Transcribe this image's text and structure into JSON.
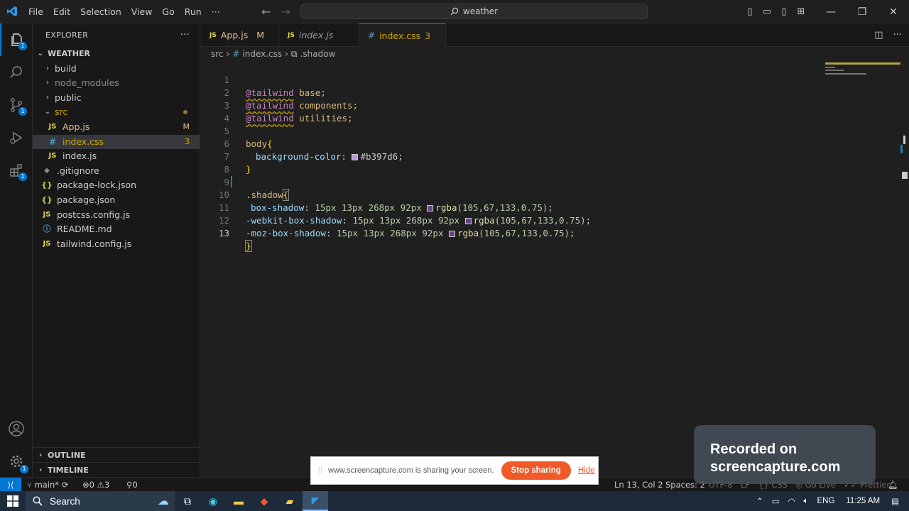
{
  "window": {
    "menu": [
      "File",
      "Edit",
      "Selection",
      "View",
      "Go",
      "Run",
      "···"
    ],
    "search_text": "weather"
  },
  "explorer": {
    "header": "EXPLORER",
    "more": "···",
    "root": "WEATHER",
    "items": [
      {
        "label": "build",
        "type": "folder",
        "depth": 1
      },
      {
        "label": "node_modules",
        "type": "folder",
        "depth": 1
      },
      {
        "label": "public",
        "type": "folder",
        "depth": 1
      },
      {
        "label": "src",
        "type": "folder-open",
        "depth": 1
      },
      {
        "label": "App.js",
        "type": "js",
        "depth": 2,
        "badge": "M"
      },
      {
        "label": "index.css",
        "type": "css",
        "depth": 2,
        "badge": "3"
      },
      {
        "label": "index.js",
        "type": "js",
        "depth": 2
      },
      {
        "label": ".gitignore",
        "type": "git",
        "depth": 1
      },
      {
        "label": "package-lock.json",
        "type": "json",
        "depth": 1
      },
      {
        "label": "package.json",
        "type": "json",
        "depth": 1
      },
      {
        "label": "postcss.config.js",
        "type": "js",
        "depth": 1
      },
      {
        "label": "README.md",
        "type": "info",
        "depth": 1
      },
      {
        "label": "tailwind.config.js",
        "type": "js",
        "depth": 1
      }
    ],
    "outline": "OUTLINE",
    "timeline": "TIMELINE"
  },
  "activity": {
    "explorer_badge": "1",
    "scm_badge": "1",
    "extensions_badge": "1"
  },
  "tabs": [
    {
      "label": "App.js",
      "icon": "JS",
      "badge": "M"
    },
    {
      "label": "index.js",
      "icon": "JS"
    },
    {
      "label": "index.css",
      "icon": "#",
      "badge": "3"
    }
  ],
  "breadcrumb": {
    "folder": "src",
    "file": "index.css",
    "symbol": ".shadow"
  },
  "code": {
    "line_numbers": [
      "1",
      "2",
      "3",
      "4",
      "5",
      "6",
      "7",
      "8",
      "9",
      "10",
      "11",
      "12",
      "13"
    ],
    "l1": {
      "at": "@tailwind",
      "rest": " base;"
    },
    "l2": {
      "at": "@tailwind",
      "rest": " components;"
    },
    "l3": {
      "at": "@tailwind",
      "rest": " utilities;"
    },
    "l5": {
      "sel": "body",
      "brace": "{"
    },
    "l6": {
      "prop": "background-color",
      "colon": ": ",
      "value": "#b397d6",
      "end": ";",
      "swatch": "#b397d6"
    },
    "l7": {
      "brace": "}"
    },
    "l9": {
      "sel": ".shadow",
      "brace": "{"
    },
    "l10": {
      "prop": "box-shadow",
      "colon": ": ",
      "nums": "15px 13px 268px 92px ",
      "fn": "rgba",
      "args": "(105,67,133,0.75)",
      "end": ";"
    },
    "l11": {
      "prop": "-webkit-box-shadow",
      "colon": ": ",
      "nums": "15px 13px 268px 92px ",
      "fn": "rgba",
      "args": "(105,67,133,0.75)",
      "end": ";"
    },
    "l12": {
      "prop": "-moz-box-shadow",
      "colon": ": ",
      "nums": "15px 13px 268px 92px ",
      "fn": "rgba",
      "args": "(105,67,133,0.75)",
      "end": ";"
    },
    "l13": {
      "brace": "}"
    },
    "shadow_swatch": "#694385"
  },
  "status": {
    "branch": "main*",
    "errors": "0",
    "warnings": "3",
    "ports": "0",
    "position": "Ln 13, Col 2",
    "spaces": "Spaces: 2",
    "encoding": "UTF-8",
    "eol": "LF",
    "language": "CSS",
    "golive": "Go Live",
    "prettier": "Prettier"
  },
  "share": {
    "message": "www.screencapture.com is sharing your screen.",
    "stop": "Stop sharing",
    "hide": "Hide"
  },
  "watermark": {
    "line1": "Recorded on",
    "line2": "screencapture.com"
  },
  "taskbar": {
    "search": "Search",
    "lang": "ENG",
    "time": "11:25 AM"
  }
}
